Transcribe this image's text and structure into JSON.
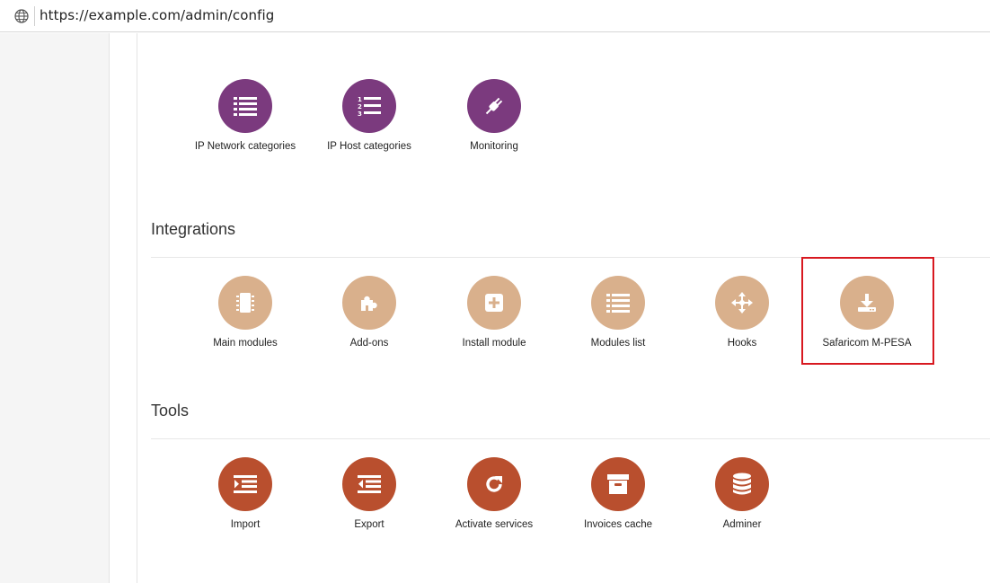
{
  "browser": {
    "url": "https://example.com/admin/config"
  },
  "colors": {
    "network": "#7b3a7e",
    "integrations": "#d9b08c",
    "tools": "#b94f2e",
    "highlight": "#d81920"
  },
  "network": {
    "items": [
      {
        "label": "IP Network categories",
        "icon": "list-icon"
      },
      {
        "label": "IP Host categories",
        "icon": "ordered-list-icon"
      },
      {
        "label": "Monitoring",
        "icon": "plug-icon"
      }
    ]
  },
  "integrations": {
    "title": "Integrations",
    "items": [
      {
        "label": "Main modules",
        "icon": "chip-icon"
      },
      {
        "label": "Add-ons",
        "icon": "puzzle-icon"
      },
      {
        "label": "Install module",
        "icon": "plus-square-icon"
      },
      {
        "label": "Modules list",
        "icon": "list-icon"
      },
      {
        "label": "Hooks",
        "icon": "move-arrows-icon"
      },
      {
        "label": "Safaricom M-PESA",
        "icon": "download-icon"
      }
    ]
  },
  "tools": {
    "title": "Tools",
    "items": [
      {
        "label": "Import",
        "icon": "indent-icon"
      },
      {
        "label": "Export",
        "icon": "outdent-icon"
      },
      {
        "label": "Activate services",
        "icon": "refresh-icon"
      },
      {
        "label": "Invoices cache",
        "icon": "archive-icon"
      },
      {
        "label": "Adminer",
        "icon": "database-icon"
      }
    ]
  }
}
